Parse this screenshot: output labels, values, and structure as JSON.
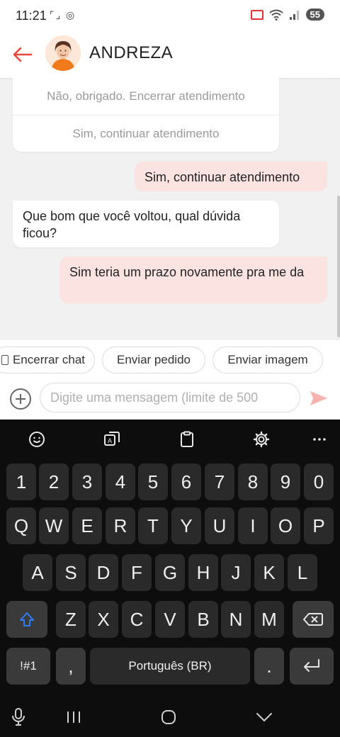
{
  "status_bar": {
    "time": "11:21",
    "left_icons": "⌜⌟ ◎",
    "battery": "55"
  },
  "header": {
    "contact_name": "ANDREZA"
  },
  "options": [
    {
      "label": "Não, obrigado. Encerrar atendimento"
    },
    {
      "label": "Sim, continuar atendimento"
    }
  ],
  "messages": [
    {
      "direction": "out",
      "text": "Sim, continuar atendimento"
    },
    {
      "direction": "in",
      "text": "Que bom que você voltou, qual dúvida ficou?"
    },
    {
      "direction": "out",
      "text": "Sim teria um prazo novamente pra me da"
    }
  ],
  "quick_actions": [
    {
      "label": "Encerrar chat"
    },
    {
      "label": "Enviar pedido"
    },
    {
      "label": "Enviar imagem"
    }
  ],
  "input": {
    "placeholder": "Digite uma mensagem (limite de 500",
    "value": ""
  },
  "keyboard": {
    "number_row": [
      "1",
      "2",
      "3",
      "4",
      "5",
      "6",
      "7",
      "8",
      "9",
      "0"
    ],
    "row1": [
      "Q",
      "W",
      "E",
      "R",
      "T",
      "Y",
      "U",
      "I",
      "O",
      "P"
    ],
    "row2": [
      "A",
      "S",
      "D",
      "F",
      "G",
      "H",
      "J",
      "K",
      "L"
    ],
    "row3": [
      "Z",
      "X",
      "C",
      "V",
      "B",
      "N",
      "M"
    ],
    "symbols_key": "!#1",
    "comma_key": ",",
    "space_label": "Português (BR)",
    "period_key": "."
  },
  "colors": {
    "accent": "#e8483b",
    "outgoing_bubble": "#fbe3e1",
    "keyboard_bg": "#0d0d0d",
    "key_bg": "#2a2a2a"
  }
}
